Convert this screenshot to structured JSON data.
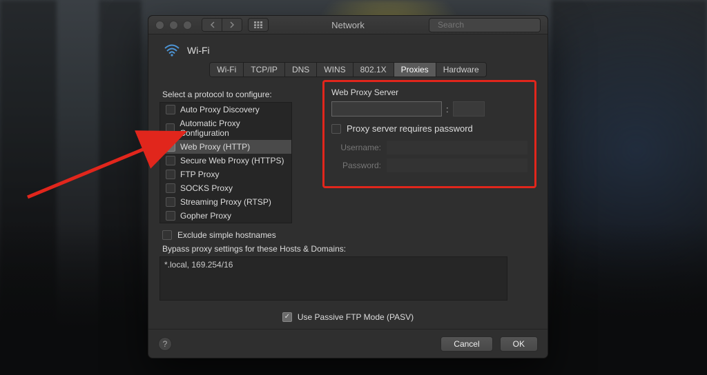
{
  "window": {
    "title": "Network"
  },
  "toolbar": {
    "search_placeholder": "Search"
  },
  "header": {
    "interface": "Wi-Fi"
  },
  "tabs": [
    "Wi-Fi",
    "TCP/IP",
    "DNS",
    "WINS",
    "802.1X",
    "Proxies",
    "Hardware"
  ],
  "active_tab": "Proxies",
  "left": {
    "select_label": "Select a protocol to configure:",
    "protocols": [
      {
        "label": "Auto Proxy Discovery",
        "checked": false,
        "selected": false
      },
      {
        "label": "Automatic Proxy Configuration",
        "checked": false,
        "selected": false
      },
      {
        "label": "Web Proxy (HTTP)",
        "checked": true,
        "selected": true
      },
      {
        "label": "Secure Web Proxy (HTTPS)",
        "checked": false,
        "selected": false
      },
      {
        "label": "FTP Proxy",
        "checked": false,
        "selected": false
      },
      {
        "label": "SOCKS Proxy",
        "checked": false,
        "selected": false
      },
      {
        "label": "Streaming Proxy (RTSP)",
        "checked": false,
        "selected": false
      },
      {
        "label": "Gopher Proxy",
        "checked": false,
        "selected": false
      }
    ]
  },
  "right": {
    "server_label": "Web Proxy Server",
    "host": "",
    "port": "",
    "requires_password_label": "Proxy server requires password",
    "requires_password": false,
    "username_label": "Username:",
    "password_label": "Password:"
  },
  "below": {
    "exclude_label": "Exclude simple hostnames",
    "exclude_checked": false,
    "bypass_label": "Bypass proxy settings for these Hosts & Domains:",
    "bypass_value": "*.local, 169.254/16",
    "pasv_label": "Use Passive FTP Mode (PASV)",
    "pasv_checked": true
  },
  "footer": {
    "cancel": "Cancel",
    "ok": "OK"
  }
}
